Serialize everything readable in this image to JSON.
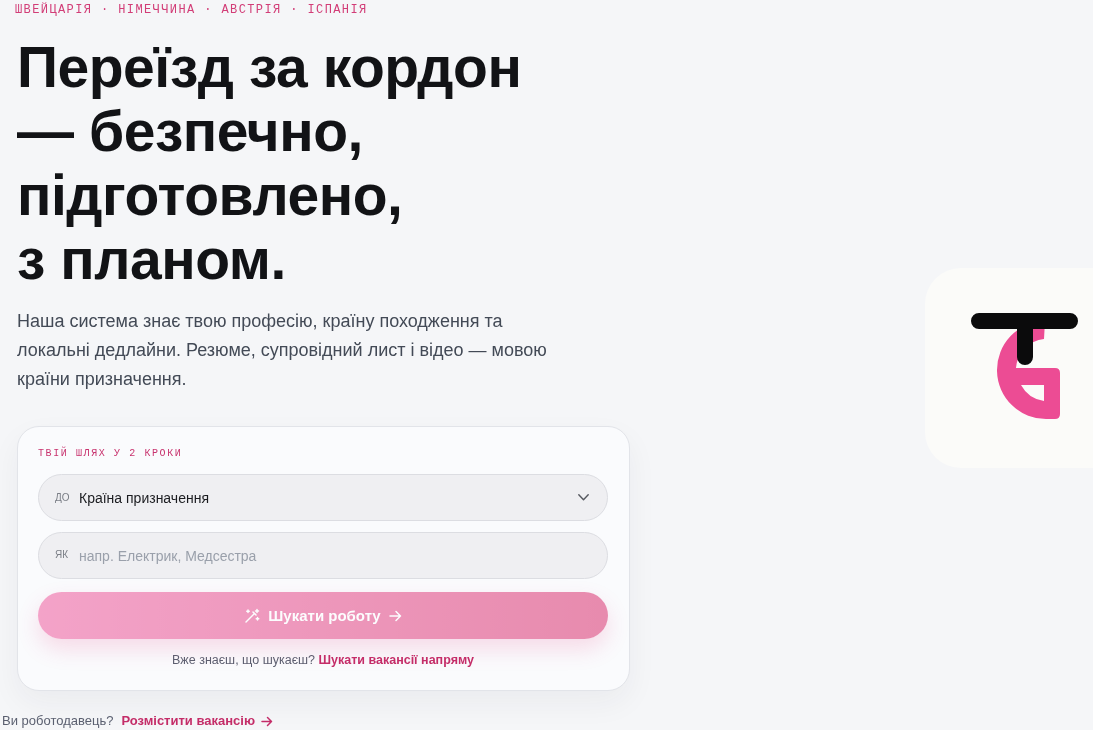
{
  "hero": {
    "eyebrow": "ШВЕЙЦАРІЯ · НІМЕЧЧИНА · АВСТРІЯ · ІСПАНІЯ",
    "title_lines": [
      "Переїзд за кордон",
      "— безпечно,",
      "підготовлено,",
      "з планом."
    ],
    "description": "Наша система знає твою професію, країну походження та локальні дедлайни. Резюме, супровідний лист і відео — мовою країни призначення."
  },
  "search_card": {
    "eyebrow": "ТВІЙ ШЛЯХ У 2 КРОКИ",
    "fields": [
      {
        "kind": "select",
        "prefix": "ДО",
        "value": "Країна призначення"
      },
      {
        "kind": "text",
        "prefix": "ЯК",
        "placeholder": "напр. Електрик, Медсестра"
      }
    ],
    "submit": {
      "label": "Шукати роботу",
      "disabled": true
    },
    "hint": {
      "text": "Вже знаєш, що шукаєш?",
      "link": "Шукати вакансії напряму"
    }
  },
  "employer": {
    "text": "Ви роботодавець?",
    "link": "Розмістити вакансію"
  }
}
